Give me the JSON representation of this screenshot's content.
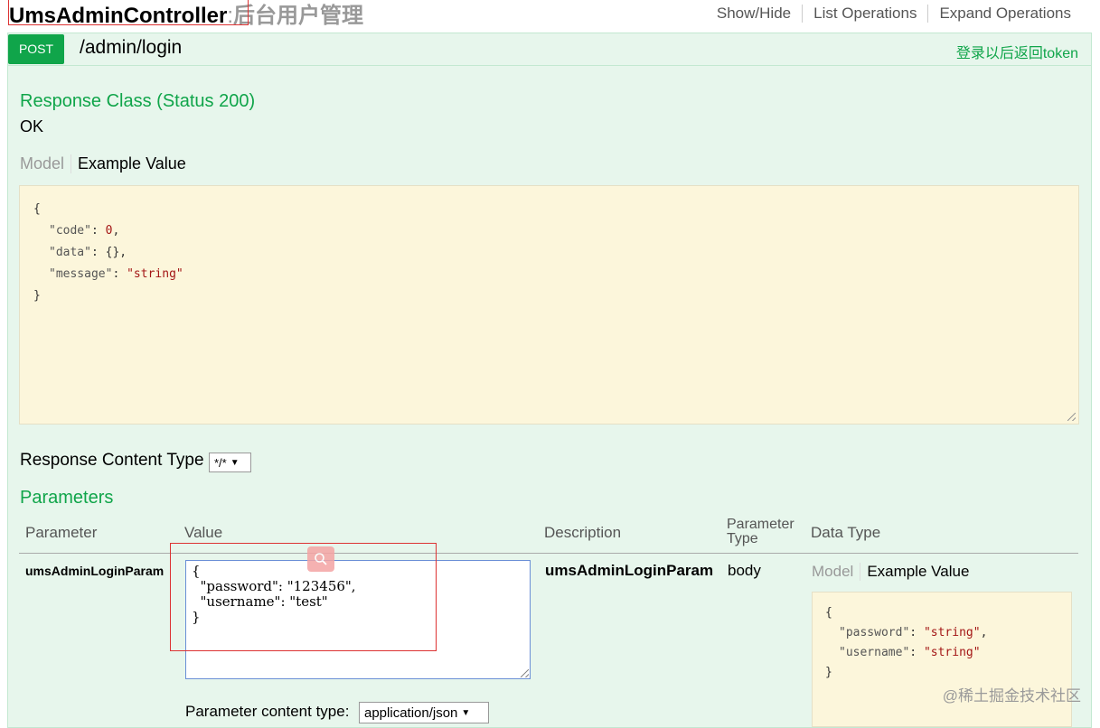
{
  "header": {
    "controller_name": "UmsAdminController",
    "separator": ":",
    "controller_desc": "后台用户管理",
    "links": [
      "Show/Hide",
      "List Operations",
      "Expand Operations"
    ]
  },
  "operation": {
    "method": "POST",
    "path": "/admin/login",
    "summary": "登录以后返回token",
    "response_class_title": "Response Class (Status 200)",
    "response_status_text": "OK",
    "tabs": {
      "model": "Model",
      "example": "Example Value"
    },
    "response_example": {
      "open": "{",
      "lines": [
        {
          "key": "\"code\"",
          "sep": ": ",
          "val": "0",
          "end": ","
        },
        {
          "key": "\"data\"",
          "sep": ": ",
          "val": "{}",
          "end": ","
        },
        {
          "key": "\"message\"",
          "sep": ": ",
          "val": "\"string\"",
          "end": ""
        }
      ],
      "close": "}"
    },
    "response_content_type_label": "Response Content Type",
    "response_content_type_value": "*/*",
    "parameters_title": "Parameters",
    "param_headers": {
      "parameter": "Parameter",
      "value": "Value",
      "description": "Description",
      "parameter_type_line1": "Parameter",
      "parameter_type_line2": "Type",
      "data_type": "Data Type"
    },
    "param": {
      "name": "umsAdminLoginParam",
      "value_lines": [
        "{",
        "  \"password\": \"123456\",",
        "  \"username\": \"test\"",
        "}"
      ],
      "description": "umsAdminLoginParam",
      "type": "body",
      "example_open": "{",
      "example_lines": [
        {
          "key": "\"password\"",
          "sep": ": ",
          "val": "\"string\"",
          "end": ","
        },
        {
          "key": "\"username\"",
          "sep": ": ",
          "val": "\"string\"",
          "end": ""
        }
      ],
      "example_close": "}",
      "content_type_label": "Parameter content type:",
      "content_type_value": "application/json"
    }
  },
  "watermark": "@稀土掘金技术社区",
  "icons": {
    "zoom": "magnifier-icon"
  },
  "colors": {
    "post": "#10a54a",
    "op_bg": "#e7f6ec",
    "code_bg": "#fcf6db",
    "highlight": "#dd3333"
  }
}
